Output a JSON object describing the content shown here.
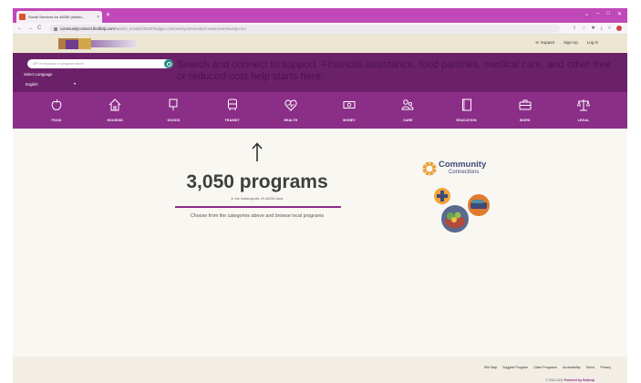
{
  "browser": {
    "tab_title": "Social Services for 46250 (Indian...",
    "close": "×",
    "new_tab": "+",
    "window_controls": [
      "⌄",
      "–",
      "□",
      "✕"
    ],
    "nav": [
      "←",
      "→",
      "C"
    ],
    "url_host": "communityconnect.findhelp.com",
    "url_path": "/search_results/46250?ladger=communityconnect&ref=www.acommunity.com",
    "ext_icons": [
      "⇪",
      "☆",
      "✱",
      "⤓",
      "□"
    ]
  },
  "site_header": {
    "links": [
      "Support",
      "Sign Up",
      "Log In"
    ]
  },
  "search": {
    "placeholder": "ZIP or keyword or program name"
  },
  "language": {
    "label": "Select Language",
    "selected": "English",
    "caret": "▾"
  },
  "tagline": "Search and connect to support. Financial assistance, food pantries, medical care, and other free or reduced-cost help starts here.",
  "categories": [
    {
      "label": "FOOD",
      "icon": "apple-icon"
    },
    {
      "label": "HOUSING",
      "icon": "house-icon"
    },
    {
      "label": "GOODS",
      "icon": "tag-icon"
    },
    {
      "label": "TRANSIT",
      "icon": "bus-icon"
    },
    {
      "label": "HEALTH",
      "icon": "heart-pulse-icon"
    },
    {
      "label": "MONEY",
      "icon": "money-icon"
    },
    {
      "label": "CARE",
      "icon": "people-icon"
    },
    {
      "label": "EDUCATION",
      "icon": "book-icon"
    },
    {
      "label": "WORK",
      "icon": "briefcase-icon"
    },
    {
      "label": "LEGAL",
      "icon": "scales-icon"
    }
  ],
  "main": {
    "count": "3,050 programs",
    "subtitle": "in the Indianapolis, IN 46250 area",
    "instruction": "Choose from the categories above and browse local programs"
  },
  "partner": {
    "name_line1": "Community",
    "name_line2": "Connections"
  },
  "footer": {
    "links": [
      "Site Map",
      "Suggest Program",
      "Claim Programs",
      "Accessibility",
      "Terms",
      "Privacy"
    ],
    "copyright": "© 2011-2022",
    "powered": "Powered by findhelp"
  }
}
